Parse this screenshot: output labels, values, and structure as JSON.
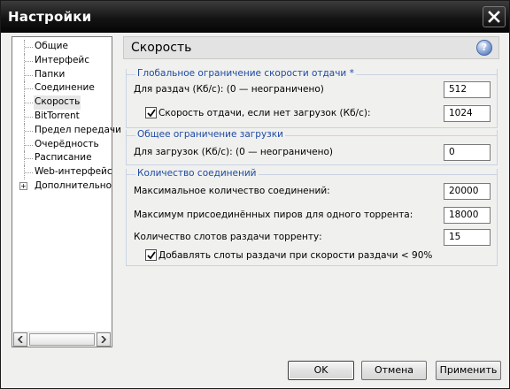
{
  "window": {
    "title": "Настройки"
  },
  "sidebar": {
    "items": [
      {
        "label": "Общие"
      },
      {
        "label": "Интерфейс"
      },
      {
        "label": "Папки"
      },
      {
        "label": "Соединение"
      },
      {
        "label": "Скорость",
        "selected": true
      },
      {
        "label": "BitTorrent"
      },
      {
        "label": "Предел передачи"
      },
      {
        "label": "Очерёдность"
      },
      {
        "label": "Расписание"
      },
      {
        "label": "Web-интерфейс"
      },
      {
        "label": "Дополнительно",
        "expandable": true
      }
    ]
  },
  "panel": {
    "title": "Скорость",
    "help_icon": "question-icon",
    "upload_group": {
      "title": "Глобальное ограничение скорости отдачи *",
      "limit_label": "Для раздач (Кб/с): (0 — неограничено)",
      "limit_value": "512",
      "idle_label": "Скорость отдачи, если нет загрузок (Кб/с):",
      "idle_checked": true,
      "idle_value": "1024"
    },
    "download_group": {
      "title": "Общее ограничение загрузки",
      "limit_label": "Для загрузок (Кб/с): (0 — неограничено)",
      "limit_value": "0"
    },
    "connections_group": {
      "title": "Количество соединений",
      "max_conn_label": "Максимальное количество соединений:",
      "max_conn_value": "20000",
      "max_peers_label": "Максимум присоединённых пиров для одного торрента:",
      "max_peers_value": "18000",
      "slots_label": "Количество слотов раздачи торренту:",
      "slots_value": "15",
      "extra_slots_label": "Добавлять слоты раздачи при скорости раздачи < 90%",
      "extra_slots_checked": true
    }
  },
  "buttons": {
    "ok": "OK",
    "cancel": "Отмена",
    "apply": "Применить"
  },
  "colors": {
    "titlebar": "#0d0d0d",
    "group_title": "#1e4aa5",
    "group_border": "#c9d3e3"
  }
}
